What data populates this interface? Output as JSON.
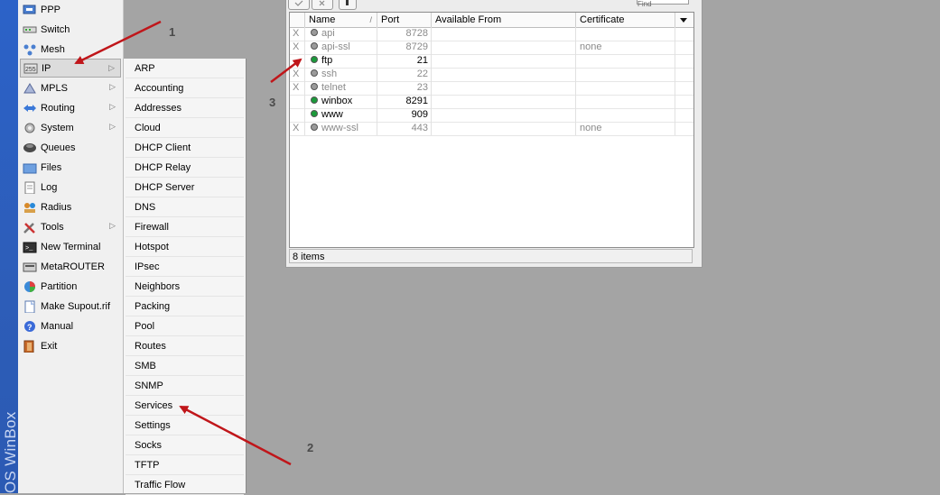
{
  "app": {
    "sidebar_brand": "OS WinBox"
  },
  "menu": {
    "items": [
      {
        "label": "PPP",
        "icon": "ppp-icon",
        "submenu": false
      },
      {
        "label": "Switch",
        "icon": "switch-icon",
        "submenu": false
      },
      {
        "label": "Mesh",
        "icon": "mesh-icon",
        "submenu": false
      },
      {
        "label": "IP",
        "icon": "ip-icon",
        "submenu": true,
        "active": true
      },
      {
        "label": "MPLS",
        "icon": "mpls-icon",
        "submenu": true
      },
      {
        "label": "Routing",
        "icon": "routing-icon",
        "submenu": true
      },
      {
        "label": "System",
        "icon": "gear-icon",
        "submenu": true
      },
      {
        "label": "Queues",
        "icon": "queues-icon",
        "submenu": false
      },
      {
        "label": "Files",
        "icon": "folder-icon",
        "submenu": false
      },
      {
        "label": "Log",
        "icon": "log-icon",
        "submenu": false
      },
      {
        "label": "Radius",
        "icon": "radius-icon",
        "submenu": false
      },
      {
        "label": "Tools",
        "icon": "tools-icon",
        "submenu": true
      },
      {
        "label": "New Terminal",
        "icon": "terminal-icon",
        "submenu": false
      },
      {
        "label": "MetaROUTER",
        "icon": "metarouter-icon",
        "submenu": false
      },
      {
        "label": "Partition",
        "icon": "partition-icon",
        "submenu": false
      },
      {
        "label": "Make Supout.rif",
        "icon": "document-icon",
        "submenu": false
      },
      {
        "label": "Manual",
        "icon": "help-icon",
        "submenu": false
      },
      {
        "label": "Exit",
        "icon": "exit-icon",
        "submenu": false
      }
    ]
  },
  "submenu": {
    "items": [
      "ARP",
      "Accounting",
      "Addresses",
      "Cloud",
      "DHCP Client",
      "DHCP Relay",
      "DHCP Server",
      "DNS",
      "Firewall",
      "Hotspot",
      "IPsec",
      "Neighbors",
      "Packing",
      "Pool",
      "Routes",
      "SMB",
      "SNMP",
      "Services",
      "Settings",
      "Socks",
      "TFTP",
      "Traffic Flow"
    ]
  },
  "services_window": {
    "find_placeholder": "Find",
    "columns": {
      "name": "Name",
      "port": "Port",
      "available_from": "Available From",
      "certificate": "Certificate"
    },
    "rows": [
      {
        "flag": "X",
        "name": "api",
        "port": "8728",
        "available_from": "",
        "certificate": "",
        "disabled": true
      },
      {
        "flag": "X",
        "name": "api-ssl",
        "port": "8729",
        "available_from": "",
        "certificate": "none",
        "disabled": true
      },
      {
        "flag": "",
        "name": "ftp",
        "port": "21",
        "available_from": "",
        "certificate": "",
        "disabled": false
      },
      {
        "flag": "X",
        "name": "ssh",
        "port": "22",
        "available_from": "",
        "certificate": "",
        "disabled": true
      },
      {
        "flag": "X",
        "name": "telnet",
        "port": "23",
        "available_from": "",
        "certificate": "",
        "disabled": true
      },
      {
        "flag": "",
        "name": "winbox",
        "port": "8291",
        "available_from": "",
        "certificate": "",
        "disabled": false
      },
      {
        "flag": "",
        "name": "www",
        "port": "909",
        "available_from": "",
        "certificate": "",
        "disabled": false
      },
      {
        "flag": "X",
        "name": "www-ssl",
        "port": "443",
        "available_from": "",
        "certificate": "none",
        "disabled": true
      }
    ],
    "status": "8 items"
  },
  "annotations": {
    "one": "1",
    "two": "2",
    "three": "3"
  },
  "colors": {
    "arrow": "#c0161a",
    "sidebar": "#2c62c8",
    "enabled_dot": "#1a9a3a",
    "disabled_dot": "#9a9a9a"
  }
}
